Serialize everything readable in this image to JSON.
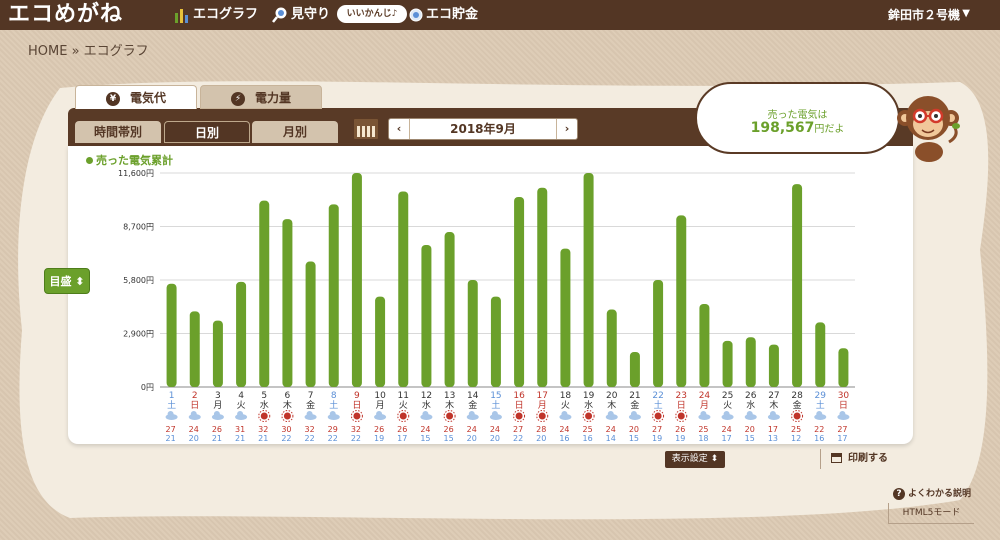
{
  "header": {
    "logo": "エコめがね",
    "nav": [
      {
        "label": "エコグラフ",
        "icon": "bar-chart-icon"
      },
      {
        "label": "見守り",
        "icon": "magnifier-icon"
      },
      {
        "label": "エコ貯金",
        "icon": "coin-icon"
      }
    ],
    "badge": "いいかんじ♪",
    "account": "鉾田市２号機"
  },
  "breadcrumb": "HOME » エコグラフ",
  "tabs": {
    "cost": {
      "label": "電気代",
      "icon": "yen-icon"
    },
    "power": {
      "label": "電力量",
      "icon": "lightning-icon"
    }
  },
  "subtabs": {
    "hour": "時間帯別",
    "day": "日別",
    "month": "月別"
  },
  "date_nav": {
    "label": "2018年9月",
    "prev": "‹",
    "next": "›"
  },
  "sold": {
    "label": "売った電気は",
    "value": "198,567",
    "suffix": "円だよ"
  },
  "legend": "売った電気累計",
  "mode_select": "目盛",
  "display_settings": "表示設定",
  "print": "印刷する",
  "help": "よくわかる説明",
  "html5": "HTML5モード",
  "colors": {
    "header": "#533624",
    "bar": "#6ba02b",
    "blue": "#5b8fd6",
    "red": "#c0342a",
    "background": "#dccab3"
  },
  "chart_data": {
    "type": "bar",
    "series": [
      {
        "name": "売った電気累計",
        "values": [
          5600,
          4100,
          3600,
          5700,
          10100,
          9100,
          6800,
          9900,
          11600,
          4900,
          10600,
          7700,
          8400,
          5800,
          4900,
          10300,
          10800,
          7500,
          11600,
          4200,
          1900,
          5800,
          9300,
          4500,
          2500,
          2700,
          2300,
          11000,
          3500,
          2100
        ]
      }
    ],
    "days": [
      "1",
      "2",
      "3",
      "4",
      "5",
      "6",
      "7",
      "8",
      "9",
      "10",
      "11",
      "12",
      "13",
      "14",
      "15",
      "16",
      "17",
      "18",
      "19",
      "20",
      "21",
      "22",
      "23",
      "24",
      "25",
      "26",
      "27",
      "28",
      "29",
      "30"
    ],
    "weekdays": [
      "土",
      "日",
      "月",
      "火",
      "水",
      "木",
      "金",
      "土",
      "日",
      "月",
      "火",
      "水",
      "木",
      "金",
      "土",
      "日",
      "月",
      "火",
      "水",
      "木",
      "金",
      "土",
      "日",
      "月",
      "火",
      "水",
      "木",
      "金",
      "土",
      "日"
    ],
    "day_colors": [
      "blue",
      "red",
      "dark",
      "dark",
      "dark",
      "dark",
      "dark",
      "blue",
      "red",
      "dark",
      "dark",
      "dark",
      "dark",
      "dark",
      "blue",
      "red",
      "red",
      "dark",
      "dark",
      "dark",
      "dark",
      "blue",
      "red",
      "red",
      "dark",
      "dark",
      "dark",
      "dark",
      "blue",
      "red"
    ],
    "weather": [
      "cloud",
      "cloud",
      "cloud",
      "cloud",
      "sun",
      "sun",
      "cloud",
      "cloud",
      "sun",
      "cloud",
      "sun",
      "cloud",
      "sun",
      "cloud",
      "cloud",
      "sun",
      "sun",
      "cloud",
      "sun",
      "cloud",
      "cloud",
      "sun",
      "sun",
      "cloud",
      "cloud",
      "cloud",
      "cloud",
      "sun",
      "cloud",
      "cloud"
    ],
    "temp_high": [
      27,
      24,
      26,
      31,
      32,
      30,
      32,
      29,
      32,
      26,
      26,
      24,
      26,
      24,
      24,
      27,
      28,
      24,
      25,
      24,
      20,
      27,
      26,
      25,
      24,
      20,
      17,
      25,
      22,
      27
    ],
    "temp_low": [
      21,
      20,
      21,
      21,
      21,
      22,
      22,
      22,
      22,
      19,
      17,
      15,
      15,
      20,
      20,
      22,
      20,
      16,
      16,
      14,
      15,
      19,
      19,
      18,
      17,
      15,
      13,
      12,
      16,
      17
    ],
    "y_ticks": [
      "0円",
      "2,900円",
      "5,800円",
      "8,700円",
      "11,600円"
    ],
    "ylim": [
      0,
      11600
    ],
    "grid": true
  }
}
